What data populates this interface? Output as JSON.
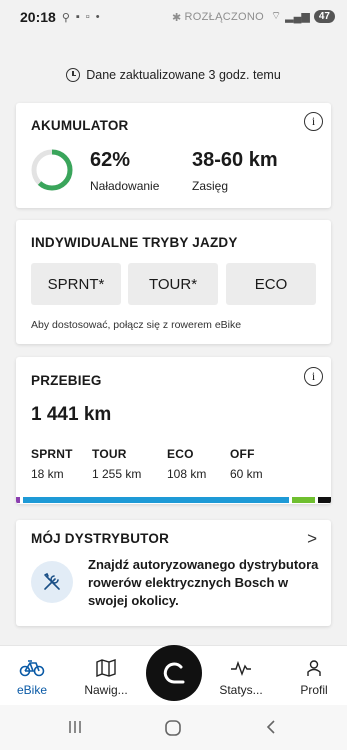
{
  "status_bar": {
    "time": "20:18",
    "connection": "ROZŁĄCZONO",
    "battery": "47"
  },
  "update_text": "Dane zaktualizowane 3 godz. temu",
  "battery_card": {
    "title": "AKUMULATOR",
    "charge_value": "62%",
    "charge_fraction": 0.62,
    "charge_label": "Naładowanie",
    "range_value": "38-60 km",
    "range_label": "Zasięg",
    "gauge_color": "#3aa55b"
  },
  "modes_card": {
    "title": "INDYWIDUALNE TRYBY JAZDY",
    "modes": [
      "SPRNT*",
      "TOUR*",
      "ECO"
    ],
    "note": "Aby dostosować, połącz się z rowerem eBike"
  },
  "mileage_card": {
    "title": "PRZEBIEG",
    "total": "1 441 km",
    "stats": [
      {
        "label": "SPRNT",
        "value": "18 km",
        "km": 18,
        "color": "#8b3fb0"
      },
      {
        "label": "TOUR",
        "value": "1 255 km",
        "km": 1255,
        "color": "#1e9ad6"
      },
      {
        "label": "ECO",
        "value": "108 km",
        "km": 108,
        "color": "#6fbf2f"
      },
      {
        "label": "OFF",
        "value": "60 km",
        "km": 60,
        "color": "#111111"
      }
    ]
  },
  "dealer_card": {
    "title": "MÓJ DYSTRYBUTOR",
    "text": "Znajdź autoryzowanego dystrybutora rowerów elektrycznych Bosch w swojej okolicy."
  },
  "bottom_nav": {
    "items": [
      {
        "label": "eBike",
        "icon": "bike-icon"
      },
      {
        "label": "Nawig...",
        "icon": "map-icon"
      },
      {
        "label": "Statys...",
        "icon": "activity-icon"
      },
      {
        "label": "Profil",
        "icon": "profile-icon"
      }
    ]
  },
  "colors": {
    "accent": "#0a5aa6",
    "gauge_track": "#e3e3e3"
  }
}
